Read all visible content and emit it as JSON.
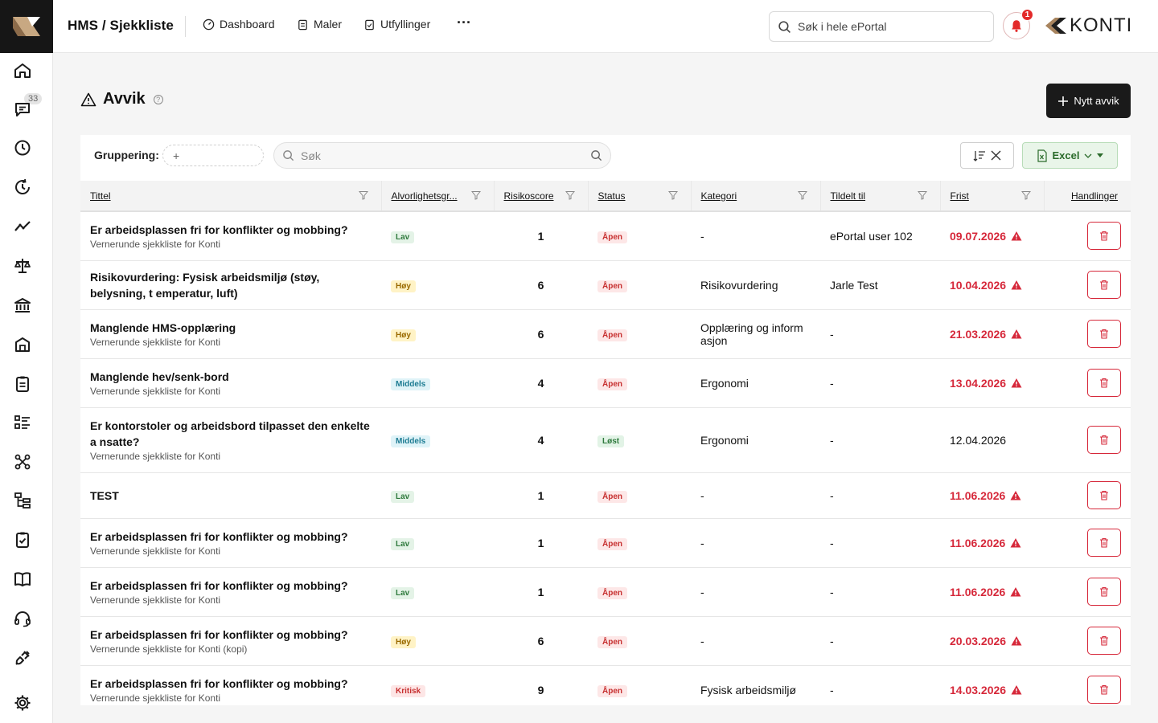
{
  "header": {
    "title": "HMS / Sjekkliste",
    "nav": [
      {
        "label": "Dashboard",
        "icon": "dashboard-icon"
      },
      {
        "label": "Maler",
        "icon": "clipboard-icon"
      },
      {
        "label": "Utfyllinger",
        "icon": "clipboard-check-icon"
      }
    ],
    "more": "···",
    "search_placeholder": "Søk i hele ePortal",
    "notification_count": "1",
    "logo_text": "KONTI"
  },
  "sidebar": {
    "messages_badge": "33",
    "items": [
      "home-icon",
      "messages-icon",
      "clock-icon",
      "history-icon",
      "trend-icon",
      "scale-icon",
      "bank-icon",
      "building-icon",
      "clipboard-icon",
      "list-icon",
      "network-icon",
      "hierarchy-icon",
      "checklist-icon",
      "book-icon",
      "headset-icon",
      "plug-icon",
      "settings-icon"
    ]
  },
  "page": {
    "title": "Avvik",
    "help": "?",
    "new_button": "Nytt avvik"
  },
  "toolbar": {
    "grouping_label": "Gruppering:",
    "grouping_add": "+",
    "search_placeholder": "Søk",
    "excel_label": "Excel"
  },
  "colors": {
    "accent_red": "#d6283a",
    "dark_button": "#1a1a1a",
    "excel_green": "#2b6b2b"
  },
  "columns": [
    "Tittel",
    "Alvorlighetsgr...",
    "Risikoscore",
    "Status",
    "Kategori",
    "Tildelt til",
    "Frist",
    "Handlinger"
  ],
  "rows": [
    {
      "title": "Er arbeidsplassen fri for konflikter og mobbing?",
      "sub": "Vernerunde sjekkliste for Konti",
      "severity": "Lav",
      "sev": "lav",
      "score": "1",
      "status": "Åpen",
      "st": "apen",
      "category": "-",
      "assignee": "ePortal user 102",
      "due": "09.07.2026",
      "overdue": true
    },
    {
      "title": "Risikovurdering: Fysisk arbeidsmiljø (støy, belysning, t emperatur, luft)",
      "sub": "",
      "severity": "Høy",
      "sev": "hoy",
      "score": "6",
      "status": "Åpen",
      "st": "apen",
      "category": "Risikovurdering",
      "assignee": "Jarle Test",
      "due": "10.04.2026",
      "overdue": true
    },
    {
      "title": "Manglende HMS-opplæring",
      "sub": "Vernerunde sjekkliste for Konti",
      "severity": "Høy",
      "sev": "hoy",
      "score": "6",
      "status": "Åpen",
      "st": "apen",
      "category": "Opplæring og inform asjon",
      "assignee": "-",
      "due": "21.03.2026",
      "overdue": true
    },
    {
      "title": "Manglende hev/senk-bord",
      "sub": "Vernerunde sjekkliste for Konti",
      "severity": "Middels",
      "sev": "middels",
      "score": "4",
      "status": "Åpen",
      "st": "apen",
      "category": "Ergonomi",
      "assignee": "-",
      "due": "13.04.2026",
      "overdue": true
    },
    {
      "title": "Er kontorstoler og arbeidsbord tilpasset den enkelte a nsatte?",
      "sub": "Vernerunde sjekkliste for Konti",
      "severity": "Middels",
      "sev": "middels",
      "score": "4",
      "status": "Løst",
      "st": "lost",
      "category": "Ergonomi",
      "assignee": "-",
      "due": "12.04.2026",
      "overdue": false
    },
    {
      "title": "TEST",
      "sub": "",
      "severity": "Lav",
      "sev": "lav",
      "score": "1",
      "status": "Åpen",
      "st": "apen",
      "category": "-",
      "assignee": "-",
      "due": "11.06.2026",
      "overdue": true
    },
    {
      "title": "Er arbeidsplassen fri for konflikter og mobbing?",
      "sub": "Vernerunde sjekkliste for Konti",
      "severity": "Lav",
      "sev": "lav",
      "score": "1",
      "status": "Åpen",
      "st": "apen",
      "category": "-",
      "assignee": "-",
      "due": "11.06.2026",
      "overdue": true
    },
    {
      "title": "Er arbeidsplassen fri for konflikter og mobbing?",
      "sub": "Vernerunde sjekkliste for Konti",
      "severity": "Lav",
      "sev": "lav",
      "score": "1",
      "status": "Åpen",
      "st": "apen",
      "category": "-",
      "assignee": "-",
      "due": "11.06.2026",
      "overdue": true
    },
    {
      "title": "Er arbeidsplassen fri for konflikter og mobbing?",
      "sub": "Vernerunde sjekkliste for Konti (kopi)",
      "severity": "Høy",
      "sev": "hoy",
      "score": "6",
      "status": "Åpen",
      "st": "apen",
      "category": "-",
      "assignee": "-",
      "due": "20.03.2026",
      "overdue": true
    },
    {
      "title": "Er arbeidsplassen fri for konflikter og mobbing?",
      "sub": "Vernerunde sjekkliste for Konti",
      "severity": "Kritisk",
      "sev": "kritisk",
      "score": "9",
      "status": "Åpen",
      "st": "apen",
      "category": "Fysisk arbeidsmiljø",
      "assignee": "-",
      "due": "14.03.2026",
      "overdue": true
    }
  ]
}
